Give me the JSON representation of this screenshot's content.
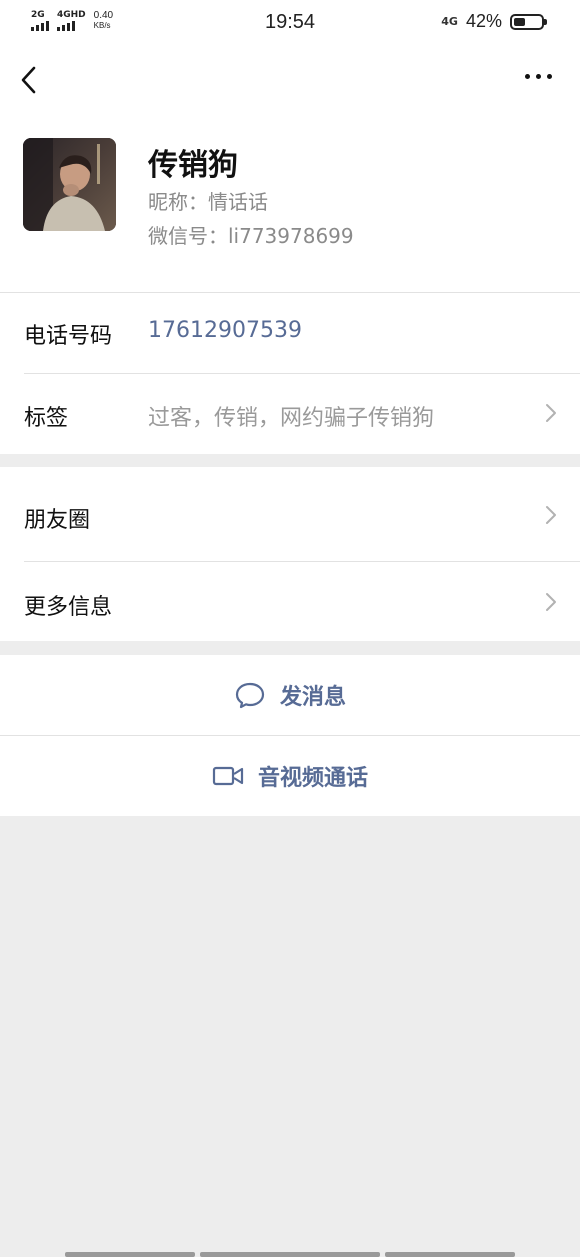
{
  "status_bar": {
    "net1": "2G",
    "net2": "4GHD",
    "speed": "0.40",
    "speed_unit": "KB/s",
    "time": "19:54",
    "signal_right": "4G",
    "battery": "42%",
    "battery_level": 0.42
  },
  "nav": {
    "back_icon": "chevron-left-icon",
    "more_icon": "more-dots-icon"
  },
  "profile": {
    "name": "传销狗",
    "nickname": "昵称：情话话",
    "wechat_id": "微信号：li773978699"
  },
  "info_rows": [
    {
      "label": "电话号码",
      "value": "17612907539"
    },
    {
      "label": "标签",
      "value": "过客，传销，网约骗子传销狗"
    }
  ],
  "menu_rows": [
    {
      "label": "朋友圈"
    },
    {
      "label": "更多信息"
    }
  ],
  "actions": {
    "message": "发消息",
    "video_call": "音视频通话"
  },
  "colors": {
    "link": "#576b95",
    "background": "#ededed",
    "secondary_text": "#8a8a8a"
  }
}
